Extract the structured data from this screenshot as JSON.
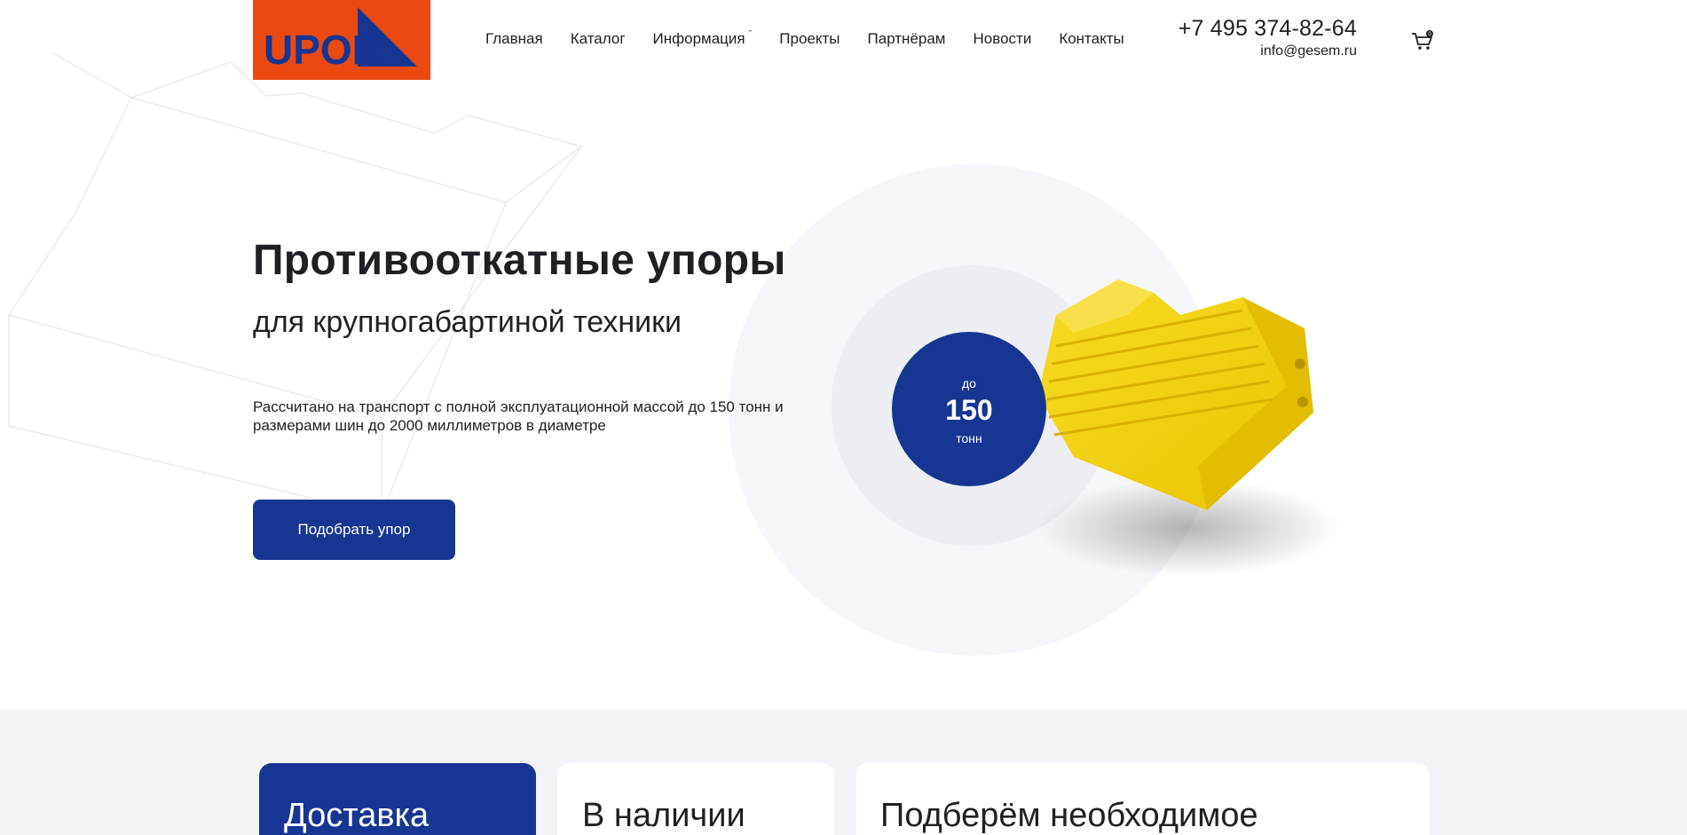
{
  "header": {
    "logo_text": "UPOR",
    "nav": [
      {
        "label": "Главная"
      },
      {
        "label": "Каталог"
      },
      {
        "label": "Информация",
        "has_dropdown": true
      },
      {
        "label": "Проекты"
      },
      {
        "label": "Партнёрам"
      },
      {
        "label": "Новости"
      },
      {
        "label": "Контакты"
      }
    ],
    "phone": "+7 495 374-82-64",
    "email": "info@gesem.ru",
    "cart_count": "0"
  },
  "hero": {
    "title": "Противооткатные упоры",
    "subtitle": "для крупногабартиной техники",
    "description": "Рассчитано на транспорт с полной эксплуатационной массой до 150 тонн и размерами шин до 2000 миллиметров в диаметре",
    "cta_label": "Подобрать упор",
    "badge": {
      "prefix": "до",
      "value": "150",
      "unit": "тонн"
    }
  },
  "features": [
    {
      "title": "Доставка"
    },
    {
      "title": "В наличии"
    },
    {
      "title": "Подберём необходимое"
    }
  ],
  "colors": {
    "brand_orange": "#ea4a12",
    "brand_blue": "#173592",
    "product_yellow": "#f5d10a"
  }
}
